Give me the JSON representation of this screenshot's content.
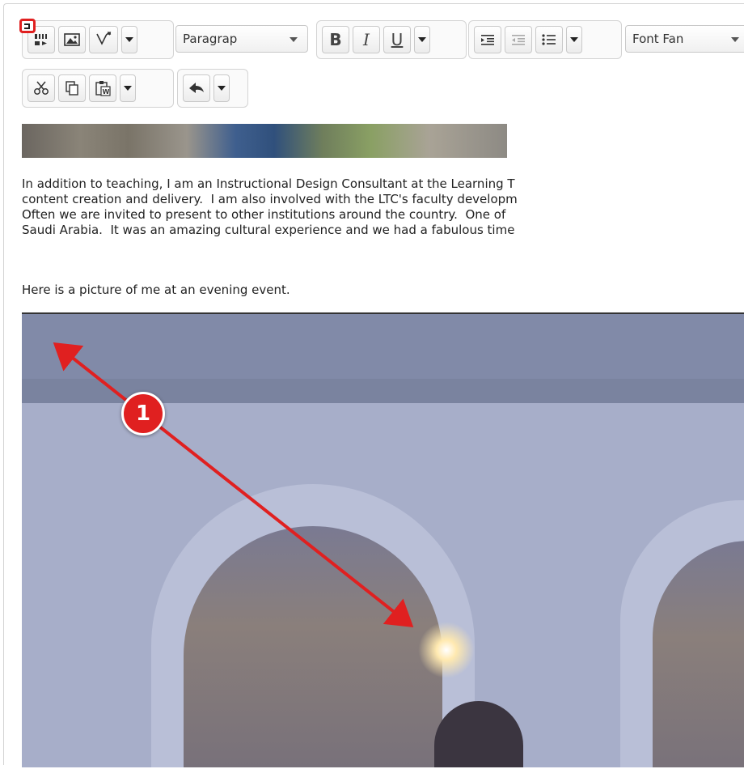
{
  "toolbar": {
    "block_format": "Paragrap",
    "font_family": "Font Fan",
    "bold_label": "B",
    "italic_label": "I",
    "underline_label": "U",
    "icons": [
      "media-icon",
      "image-icon",
      "equation-icon",
      "bold-icon",
      "italic-icon",
      "underline-icon",
      "indent-icon",
      "outdent-icon",
      "bullet-list-icon",
      "cut-icon",
      "copy-icon",
      "paste-word-icon",
      "undo-icon"
    ]
  },
  "content": {
    "paragraph_lines": [
      "In addition to teaching, I am an Instructional Design Consultant at the Learning T",
      "content creation and delivery.  I am also involved with the LTC's faculty developm",
      "Often we are invited to present to other institutions around the country.  One of",
      "Saudi Arabia.  It was an amazing cultural experience and we had a fabulous time"
    ],
    "caption": "Here is a picture of me at an evening event."
  },
  "annotation": {
    "number": "1",
    "color": "#e02020"
  }
}
